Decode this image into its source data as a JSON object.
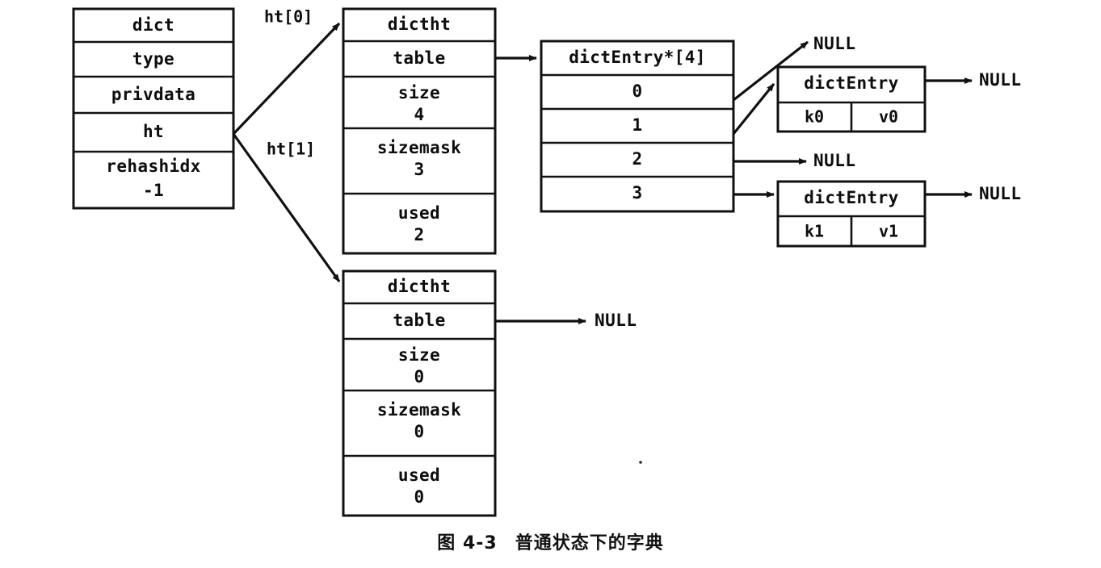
{
  "figure": {
    "caption_number": "图 4-3",
    "caption_title": "普通状态下的字典"
  },
  "dict_struct": {
    "title": "dict",
    "fields": [
      {
        "name": "type",
        "value": ""
      },
      {
        "name": "privdata",
        "value": ""
      },
      {
        "name": "ht",
        "value": ""
      },
      {
        "name": "rehashidx",
        "value": "-1"
      }
    ]
  },
  "edge_labels": {
    "ht0": "ht[0]",
    "ht1": "ht[1]"
  },
  "hashtable_0": {
    "title": "dictht",
    "fields": [
      {
        "name": "table",
        "value": ""
      },
      {
        "name": "size",
        "value": "4"
      },
      {
        "name": "sizemask",
        "value": "3"
      },
      {
        "name": "used",
        "value": "2"
      }
    ]
  },
  "hashtable_1": {
    "title": "dictht",
    "fields": [
      {
        "name": "table",
        "value": ""
      },
      {
        "name": "size",
        "value": "0"
      },
      {
        "name": "sizemask",
        "value": "0"
      },
      {
        "name": "used",
        "value": "0"
      }
    ],
    "table_target": "NULL"
  },
  "bucket_array": {
    "title": "dictEntry*[4]",
    "buckets": [
      {
        "index": "0",
        "target": "NULL"
      },
      {
        "index": "1",
        "target": "dictEntry k0"
      },
      {
        "index": "2",
        "target": "NULL"
      },
      {
        "index": "3",
        "target": "dictEntry k1"
      }
    ]
  },
  "entries": [
    {
      "title": "dictEntry",
      "key": "k0",
      "value": "v0",
      "next": "NULL"
    },
    {
      "title": "dictEntry",
      "key": "k1",
      "value": "v1",
      "next": "NULL"
    }
  ],
  "null_labels": {
    "bucket0": "NULL",
    "bucket2": "NULL",
    "entry0_next": "NULL",
    "entry1_next": "NULL",
    "ht1_table": "NULL"
  },
  "colors": {
    "stroke": "#111111",
    "background": "#ffffff",
    "text": "#0d0d0d"
  }
}
